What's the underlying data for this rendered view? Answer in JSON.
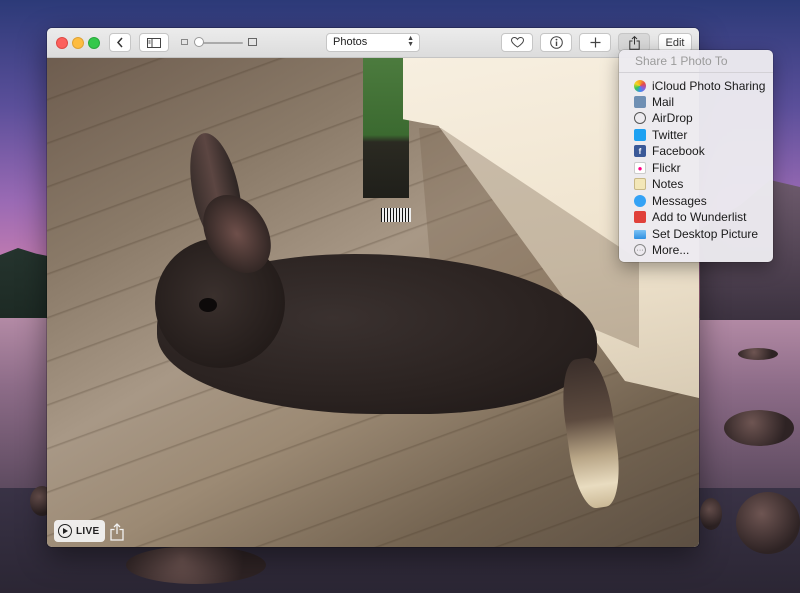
{
  "toolbar": {
    "view_select_value": "Photos",
    "edit_label": "Edit"
  },
  "photo": {
    "live_label": "LIVE"
  },
  "share_menu": {
    "header": "Share 1 Photo To",
    "items": [
      {
        "label": "iCloud Photo Sharing",
        "icon": "icloud-photo-sharing-icon",
        "color": "#f5a623"
      },
      {
        "label": "Mail",
        "icon": "mail-icon",
        "color": "#6f8fb3"
      },
      {
        "label": "AirDrop",
        "icon": "airdrop-icon",
        "color": "#555555"
      },
      {
        "label": "Twitter",
        "icon": "twitter-icon",
        "color": "#1da1f2"
      },
      {
        "label": "Facebook",
        "icon": "facebook-icon",
        "color": "#3b5998"
      },
      {
        "label": "Flickr",
        "icon": "flickr-icon",
        "color": "#ff0084"
      },
      {
        "label": "Notes",
        "icon": "notes-icon",
        "color": "#e8d8a0"
      },
      {
        "label": "Messages",
        "icon": "messages-icon",
        "color": "#34a2f5"
      },
      {
        "label": "Add to Wunderlist",
        "icon": "wunderlist-icon",
        "color": "#e0403a"
      },
      {
        "label": "Set Desktop Picture",
        "icon": "desktop-picture-icon",
        "color": "#4aa3e8"
      },
      {
        "label": "More...",
        "icon": "more-icon",
        "color": "#888888"
      }
    ]
  }
}
